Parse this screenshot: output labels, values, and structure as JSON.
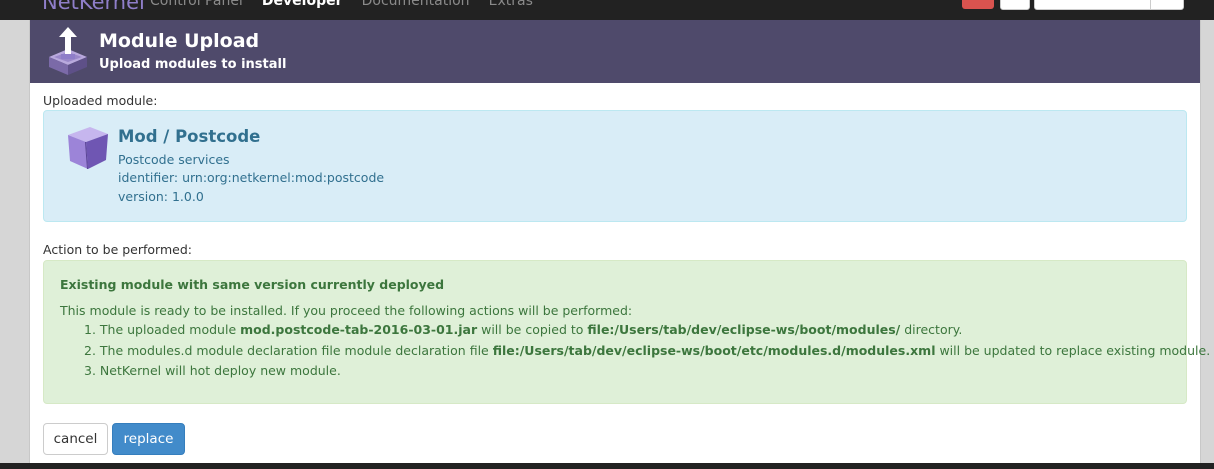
{
  "navbar": {
    "brand": "NetKernel",
    "links": [
      "Control Panel",
      "Developer",
      "Documentation",
      "Extras"
    ],
    "active_index": 1
  },
  "header": {
    "title": "Module Upload",
    "subtitle": "Upload modules to install",
    "icon": "upload-tray-icon"
  },
  "uploaded": {
    "label": "Uploaded module:",
    "module_title": "Mod / Postcode",
    "description": "Postcode services",
    "identifier": "identifier: urn:org:netkernel:mod:postcode",
    "version": "version: 1.0.0",
    "icon": "module-box-icon"
  },
  "action": {
    "label": "Action to be performed:",
    "title": "Existing module with same version currently deployed",
    "intro": "This module is ready to be installed. If you proceed the following actions will be performed:",
    "steps": [
      {
        "prefix": "1. The uploaded module ",
        "bold1": "mod.postcode-tab-2016-03-01.jar",
        "middle": " will be copied to ",
        "bold2": "file:/Users/tab/dev/eclipse-ws/boot/modules/",
        "suffix": " directory."
      },
      {
        "prefix": "2. The modules.d module declaration file module declaration file ",
        "bold1": "file:/Users/tab/dev/eclipse-ws/boot/etc/modules.d/modules.xml",
        "middle": " will be updated to replace existing module.",
        "bold2": "",
        "suffix": ""
      },
      {
        "prefix": "3. NetKernel will hot deploy new module.",
        "bold1": "",
        "middle": "",
        "bold2": "",
        "suffix": ""
      }
    ]
  },
  "buttons": {
    "cancel": "cancel",
    "replace": "replace"
  },
  "colors": {
    "header_bg": "#4f4a6b",
    "info_bg": "#d9edf7",
    "info_text": "#31708f",
    "success_bg": "#dff0d8",
    "success_text": "#3c763d",
    "primary": "#428bca"
  }
}
